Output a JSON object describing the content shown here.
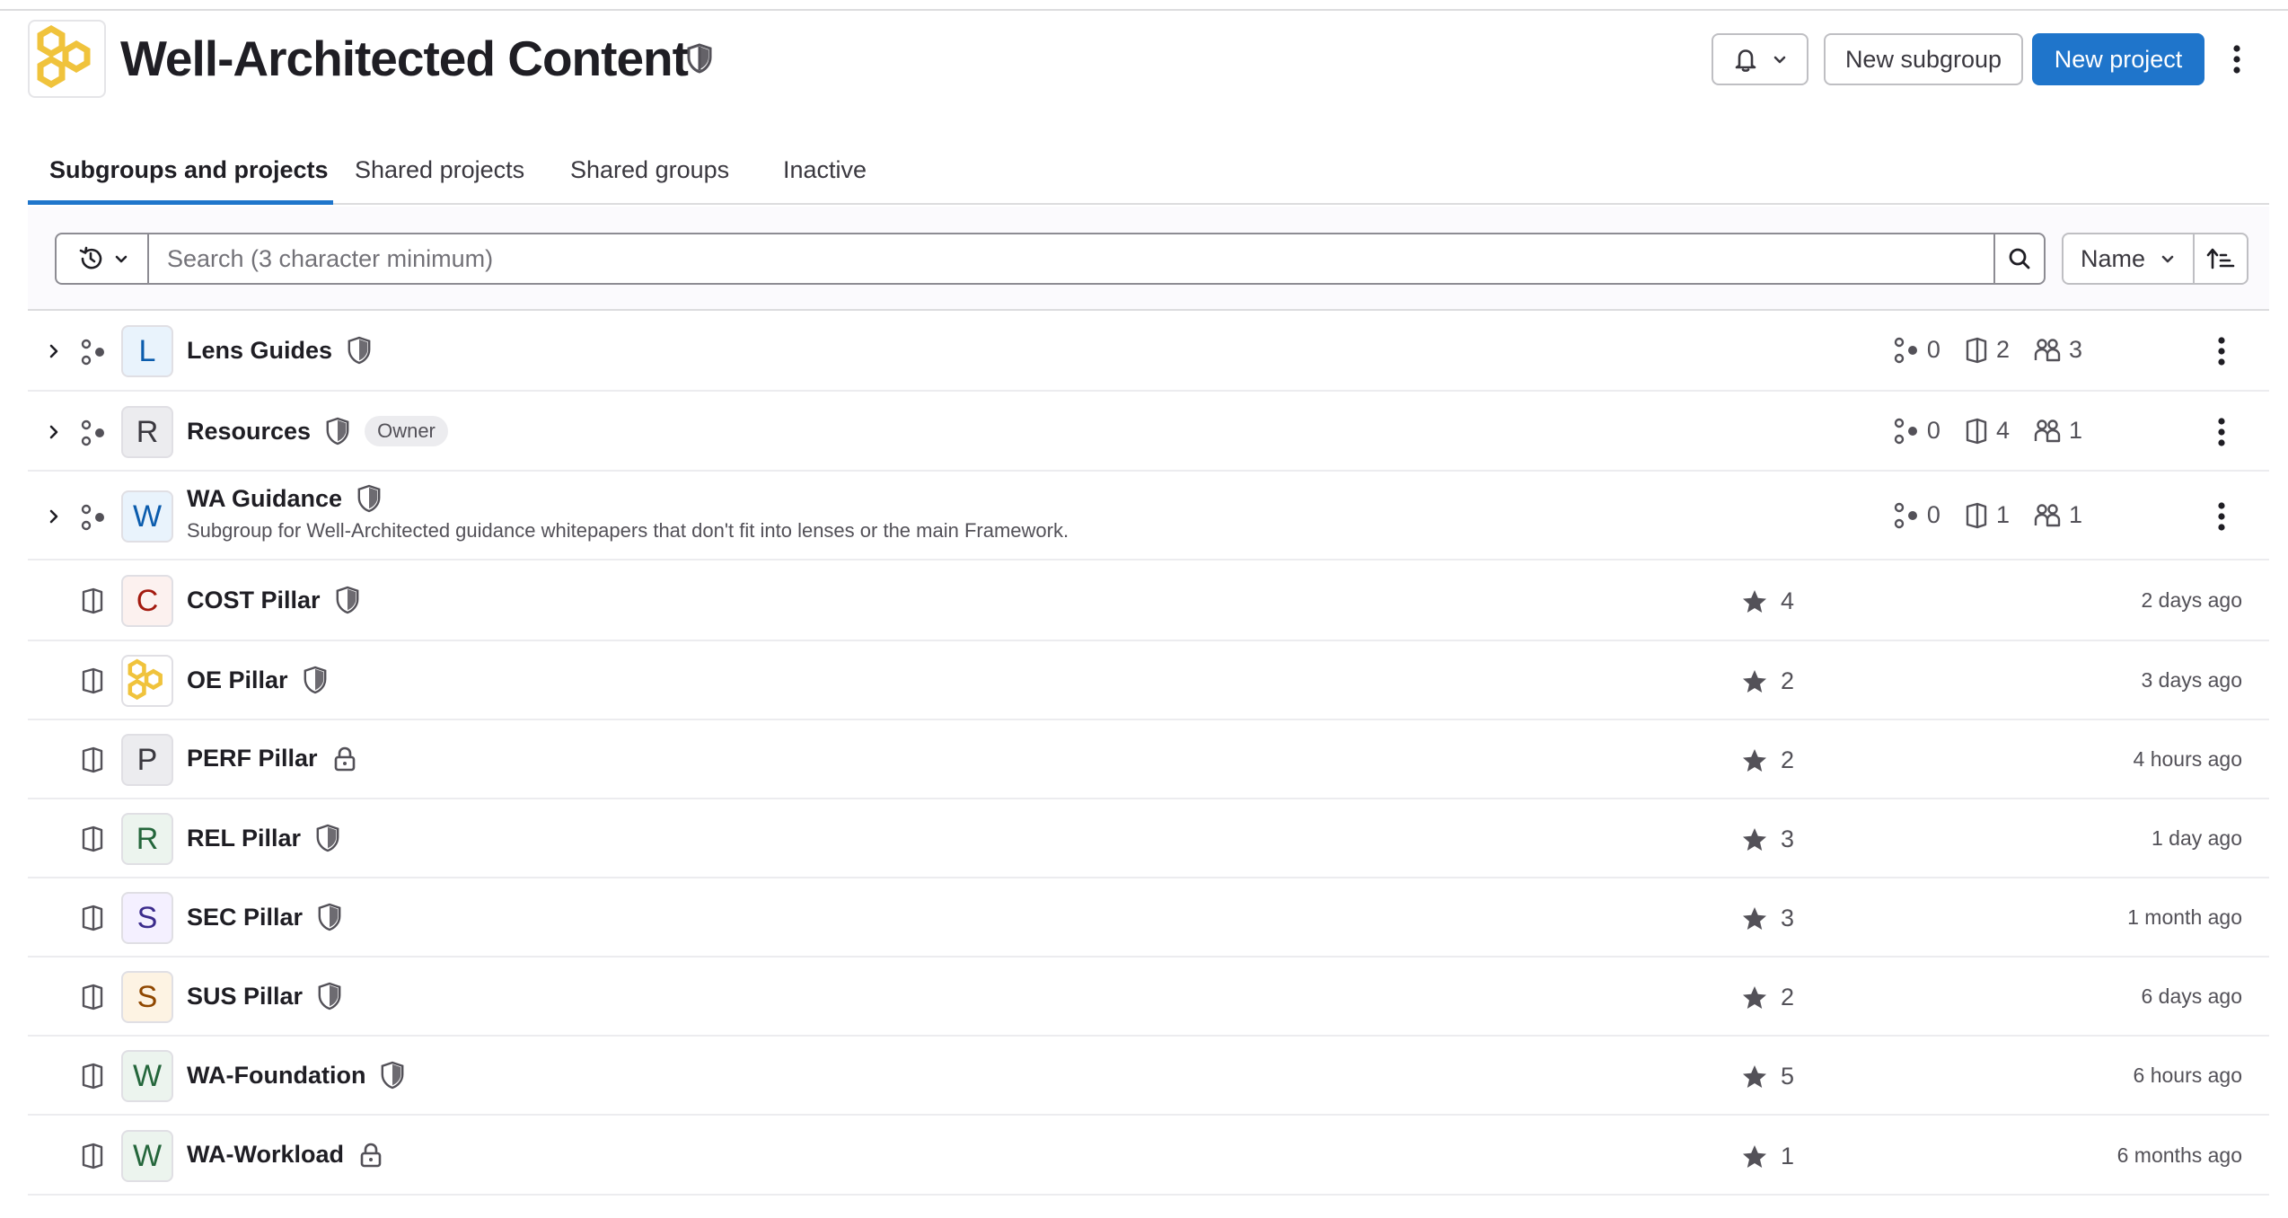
{
  "header": {
    "title": "Well-Architected Content",
    "new_subgroup_label": "New subgroup",
    "new_project_label": "New project"
  },
  "tabs": [
    {
      "label": "Subgroups and projects",
      "active": true
    },
    {
      "label": "Shared projects",
      "active": false
    },
    {
      "label": "Shared groups",
      "active": false
    },
    {
      "label": "Inactive",
      "active": false
    }
  ],
  "filter": {
    "search_placeholder": "Search (3 character minimum)",
    "search_value": "",
    "sort_label": "Name"
  },
  "colors": {
    "primary": "#1f75cb",
    "logo_yellow": "#f0c33c"
  },
  "subgroups": [
    {
      "letter": "L",
      "name": "Lens Guides",
      "visibility": "shield-icon",
      "badge": "",
      "description": "",
      "subgroups": "0",
      "projects": "2",
      "members": "3",
      "avatar_bg": "#e9f3fc",
      "avatar_fg": "#0b5cad"
    },
    {
      "letter": "R",
      "name": "Resources",
      "visibility": "shield-icon",
      "badge": "Owner",
      "description": "",
      "subgroups": "0",
      "projects": "4",
      "members": "1",
      "avatar_bg": "#ececef",
      "avatar_fg": "#3a383f"
    },
    {
      "letter": "W",
      "name": "WA Guidance",
      "visibility": "shield-icon",
      "badge": "",
      "description": "Subgroup for Well-Architected guidance whitepapers that don't fit into lenses or the main Framework.",
      "subgroups": "0",
      "projects": "1",
      "members": "1",
      "avatar_bg": "#e9f3fc",
      "avatar_fg": "#0b5cad"
    }
  ],
  "projects": [
    {
      "letter": "C",
      "name": "COST Pillar",
      "visibility": "shield-icon",
      "stars": "4",
      "updated": "2 days ago",
      "avatar_bg": "#fcf1ef",
      "avatar_fg": "#a3190e",
      "logo": false
    },
    {
      "letter": "",
      "name": "OE Pillar",
      "visibility": "shield-icon",
      "stars": "2",
      "updated": "3 days ago",
      "avatar_bg": "#ffffff",
      "avatar_fg": "#f0c33c",
      "logo": true
    },
    {
      "letter": "P",
      "name": "PERF Pillar",
      "visibility": "lock-icon",
      "stars": "2",
      "updated": "4 hours ago",
      "avatar_bg": "#ececef",
      "avatar_fg": "#3a383f",
      "logo": false
    },
    {
      "letter": "R",
      "name": "REL Pillar",
      "visibility": "shield-icon",
      "stars": "3",
      "updated": "1 day ago",
      "avatar_bg": "#ecf4ee",
      "avatar_fg": "#24663b",
      "logo": false
    },
    {
      "letter": "S",
      "name": "SEC Pillar",
      "visibility": "shield-icon",
      "stars": "3",
      "updated": "1 month ago",
      "avatar_bg": "#f4f0ff",
      "avatar_fg": "#3b2b8c",
      "logo": false
    },
    {
      "letter": "S",
      "name": "SUS Pillar",
      "visibility": "shield-icon",
      "stars": "2",
      "updated": "6 days ago",
      "avatar_bg": "#fdf3e3",
      "avatar_fg": "#8f4700",
      "logo": false
    },
    {
      "letter": "W",
      "name": "WA-Foundation",
      "visibility": "shield-icon",
      "stars": "5",
      "updated": "6 hours ago",
      "avatar_bg": "#ecf4ee",
      "avatar_fg": "#24663b",
      "logo": false
    },
    {
      "letter": "W",
      "name": "WA-Workload",
      "visibility": "lock-icon",
      "stars": "1",
      "updated": "6 months ago",
      "avatar_bg": "#ecf4ee",
      "avatar_fg": "#24663b",
      "logo": false
    }
  ]
}
